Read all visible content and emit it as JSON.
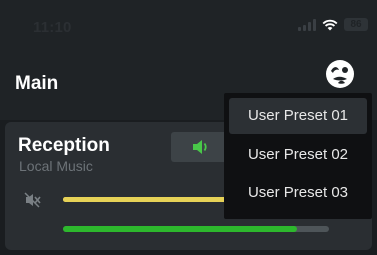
{
  "status_bar": {
    "time": "11:10",
    "battery": "86"
  },
  "header": {
    "title": "Main"
  },
  "zone": {
    "name": "Reception",
    "source": "Local Music",
    "volume_level": 1.0,
    "signal_level": 0.88
  },
  "preset_menu": {
    "items": [
      {
        "label": "User Preset 01",
        "selected": true
      },
      {
        "label": "User Preset 02",
        "selected": false
      },
      {
        "label": "User Preset 03",
        "selected": false
      }
    ]
  },
  "colors": {
    "accent_green": "#2db82d",
    "volume_yellow": "#e6d257",
    "speaker_green": "#49c849"
  },
  "icons": {
    "logo": "logo-icon",
    "speaker": "speaker-icon",
    "mute": "mute-icon",
    "wifi": "wifi-icon",
    "signal": "signal-icon",
    "battery": "battery-icon"
  }
}
